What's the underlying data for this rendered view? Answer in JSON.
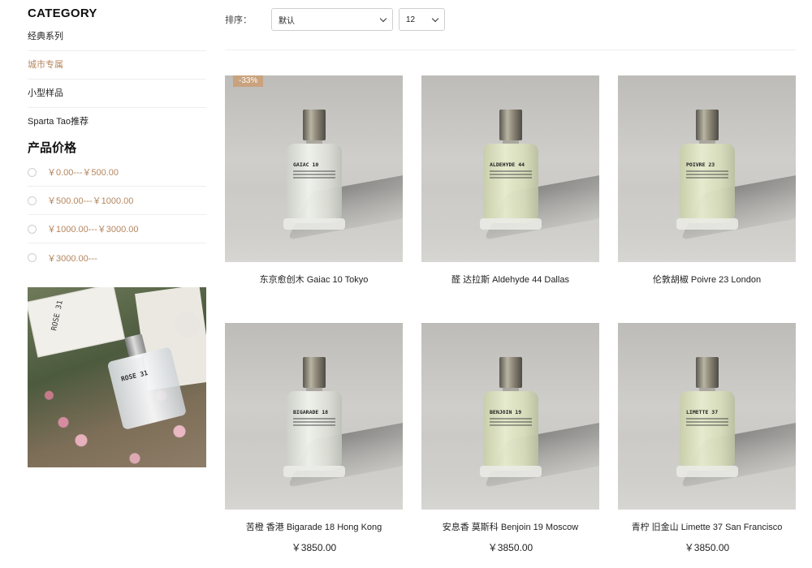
{
  "sidebar": {
    "category_title": "CATEGORY",
    "categories": [
      {
        "label": "经典系列"
      },
      {
        "label": "城市专属"
      },
      {
        "label": "小型样品"
      },
      {
        "label": "Sparta Tao推荐"
      }
    ],
    "price_title": "产品价格",
    "price_ranges": [
      {
        "label": "￥0.00---￥500.00"
      },
      {
        "label": "￥500.00---￥1000.00"
      },
      {
        "label": "￥1000.00---￥3000.00"
      },
      {
        "label": "￥3000.00---"
      }
    ],
    "promo": {
      "box_label": "ROSE 31",
      "bottle_label": "ROSE 31"
    }
  },
  "toolbar": {
    "sort_label": "排序：",
    "sort_value": "默认",
    "count_value": "12"
  },
  "products": [
    {
      "name": "东京愈创木 Gaiac 10 Tokyo",
      "bottle_label": "GAIAC 10",
      "badge": "-33%",
      "price": ""
    },
    {
      "name": "醛 达拉斯 Aldehyde 44 Dallas",
      "bottle_label": "ALDEHYDE 44",
      "badge": "",
      "price": ""
    },
    {
      "name": "伦敦胡椒 Poivre 23 London",
      "bottle_label": "POIVRE 23",
      "badge": "",
      "price": ""
    },
    {
      "name": "苦橙 香港 Bigarade 18 Hong Kong",
      "bottle_label": "BIGARADE 18",
      "badge": "",
      "price": "￥3850.00"
    },
    {
      "name": "安息香 莫斯科 Benjoin 19 Moscow",
      "bottle_label": "BENJOIN 19",
      "badge": "",
      "price": "￥3850.00"
    },
    {
      "name": "青柠 旧金山 Limette 37 San Francisco",
      "bottle_label": "LIMETTE 37",
      "badge": "",
      "price": "￥3850.00"
    }
  ],
  "colors": {
    "accent": "#b5865e",
    "badge_bg": "#c9a27e"
  }
}
